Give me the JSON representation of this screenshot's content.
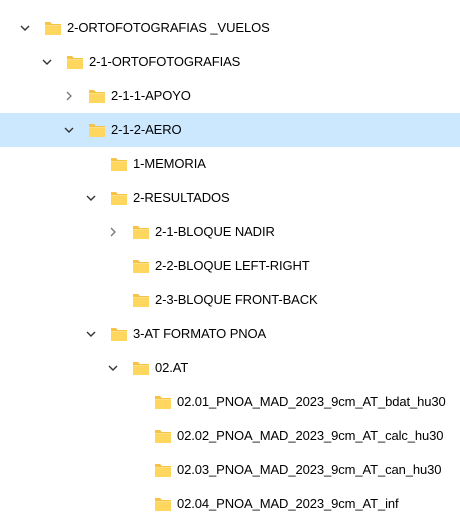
{
  "colors": {
    "selection": "#cce8ff",
    "folder_fill": "#ffd75e",
    "folder_back": "#f6c342",
    "chevron": "#333333",
    "chevron_muted": "#777777"
  },
  "icons": {
    "expanded": "chevron-down-icon",
    "collapsed": "chevron-right-icon",
    "folder": "folder-icon"
  },
  "tree": [
    {
      "label": "2-ORTOFOTOGRAFIAS _VUELOS",
      "depth": 0,
      "state": "expanded",
      "selected": false
    },
    {
      "label": "2-1-ORTOFOTOGRAFIAS",
      "depth": 1,
      "state": "expanded",
      "selected": false
    },
    {
      "label": "2-1-1-APOYO",
      "depth": 2,
      "state": "collapsed",
      "selected": false
    },
    {
      "label": "2-1-2-AERO",
      "depth": 2,
      "state": "expanded",
      "selected": true
    },
    {
      "label": "1-MEMORIA",
      "depth": 3,
      "state": "none",
      "selected": false
    },
    {
      "label": "2-RESULTADOS",
      "depth": 3,
      "state": "expanded",
      "selected": false
    },
    {
      "label": "2-1-BLOQUE NADIR",
      "depth": 4,
      "state": "collapsed",
      "selected": false
    },
    {
      "label": "2-2-BLOQUE LEFT-RIGHT",
      "depth": 4,
      "state": "none",
      "selected": false
    },
    {
      "label": "2-3-BLOQUE FRONT-BACK",
      "depth": 4,
      "state": "none",
      "selected": false
    },
    {
      "label": "3-AT FORMATO PNOA",
      "depth": 3,
      "state": "expanded",
      "selected": false
    },
    {
      "label": "02.AT",
      "depth": 4,
      "state": "expanded",
      "selected": false
    },
    {
      "label": "02.01_PNOA_MAD_2023_9cm_AT_bdat_hu30",
      "depth": 5,
      "state": "none",
      "selected": false
    },
    {
      "label": "02.02_PNOA_MAD_2023_9cm_AT_calc_hu30",
      "depth": 5,
      "state": "none",
      "selected": false
    },
    {
      "label": "02.03_PNOA_MAD_2023_9cm_AT_can_hu30",
      "depth": 5,
      "state": "none",
      "selected": false
    },
    {
      "label": "02.04_PNOA_MAD_2023_9cm_AT_inf",
      "depth": 5,
      "state": "none",
      "selected": false
    }
  ]
}
